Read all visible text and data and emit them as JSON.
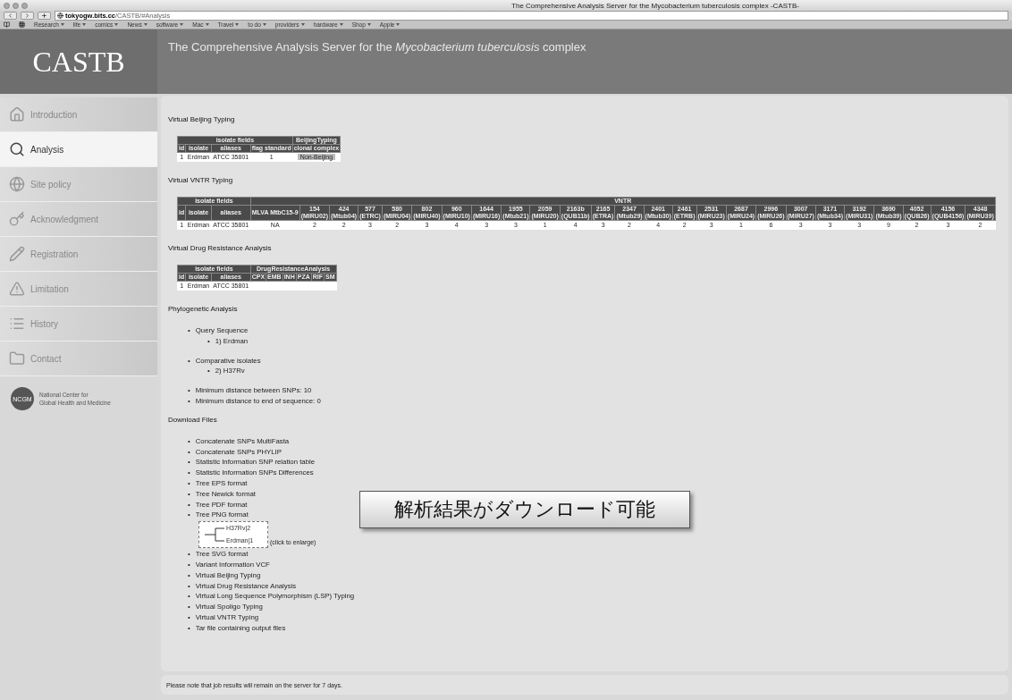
{
  "browser": {
    "title": "The Comprehensive Analysis Server for the Mycobacterium tuberculosis complex -CASTB-",
    "url_host": "tokyogw.bits.cc",
    "url_path": "/CASTB/#Analysis",
    "bookmarks": [
      "Research",
      "life",
      "comics",
      "News",
      "software",
      "Mac",
      "Travel",
      "to do",
      "providers",
      "hardware",
      "Shop",
      "Apple"
    ]
  },
  "header": {
    "logo": "CASTB",
    "tagline": "The Comprehensive Analysis Server for the *Mycobacterium tuberculosis* complex"
  },
  "sidebar": {
    "items": [
      {
        "label": "Introduction",
        "selected": false
      },
      {
        "label": "Analysis",
        "selected": true
      },
      {
        "label": "Site policy",
        "selected": false
      },
      {
        "label": "Acknowledgment",
        "selected": false
      },
      {
        "label": "Registration",
        "selected": false
      },
      {
        "label": "Limitation",
        "selected": false
      },
      {
        "label": "History",
        "selected": false
      },
      {
        "label": "Contact",
        "selected": false
      }
    ],
    "org": {
      "badge": "NCGM",
      "lines": [
        "National Center for",
        "Global Health and Medicine"
      ]
    }
  },
  "sections": [
    {
      "kind": "table",
      "title": "Virtual Beijing Typing",
      "groups": [
        {
          "label": "isolate fields",
          "columns": [
            {
              "label": "id"
            },
            {
              "label": "isolate"
            },
            {
              "label": "aliases"
            },
            {
              "label": "flag standard"
            }
          ]
        },
        {
          "label": "BeijingTyping",
          "columns": [
            {
              "label": "clonal complex"
            }
          ]
        }
      ],
      "rows": [
        [
          {
            "text": "1"
          },
          {
            "text": "Erdman"
          },
          {
            "text": "ATCC 35801"
          },
          {
            "text": "1"
          },
          {
            "text": "Non-Beijing",
            "tag": true
          }
        ]
      ]
    },
    {
      "kind": "table",
      "title": "Virtual VNTR Typing",
      "groups": [
        {
          "label": "isolate fields",
          "columns": [
            {
              "label": "id"
            },
            {
              "label": "isolate"
            },
            {
              "label": "aliases"
            }
          ]
        },
        {
          "label": "VNTR",
          "columns": [
            {
              "label": "MLVA MtbC15-9"
            },
            {
              "label": "154",
              "sub": "(MIRU02)"
            },
            {
              "label": "424",
              "sub": "(Mtub04)"
            },
            {
              "label": "577",
              "sub": "(ETRC)"
            },
            {
              "label": "580",
              "sub": "(MIRU04)"
            },
            {
              "label": "802",
              "sub": "(MIRU40)"
            },
            {
              "label": "960",
              "sub": "(MIRU10)"
            },
            {
              "label": "1644",
              "sub": "(MIRU16)"
            },
            {
              "label": "1955",
              "sub": "(Mtub21)"
            },
            {
              "label": "2059",
              "sub": "(MIRU20)"
            },
            {
              "label": "2163b",
              "sub": "(QUB11b)"
            },
            {
              "label": "2165",
              "sub": "(ETRA)"
            },
            {
              "label": "2347",
              "sub": "(Mtub29)"
            },
            {
              "label": "2401",
              "sub": "(Mtub30)"
            },
            {
              "label": "2461",
              "sub": "(ETRB)"
            },
            {
              "label": "2531",
              "sub": "(MIRU23)"
            },
            {
              "label": "2687",
              "sub": "(MIRU24)"
            },
            {
              "label": "2996",
              "sub": "(MIRU26)"
            },
            {
              "label": "3007",
              "sub": "(MIRU27)"
            },
            {
              "label": "3171",
              "sub": "(Mtub34)"
            },
            {
              "label": "3192",
              "sub": "(MIRU31)"
            },
            {
              "label": "3690",
              "sub": "(Mtub39)"
            },
            {
              "label": "4052",
              "sub": "(QUB26)"
            },
            {
              "label": "4156",
              "sub": "(QUB4156)"
            },
            {
              "label": "4348",
              "sub": "(MIRU39)"
            }
          ]
        }
      ],
      "rows": [
        [
          {
            "text": "1"
          },
          {
            "text": "Erdman"
          },
          {
            "text": "ATCC 35801"
          },
          {
            "text": "NA"
          },
          {
            "text": "2"
          },
          {
            "text": "2"
          },
          {
            "text": "3"
          },
          {
            "text": "2"
          },
          {
            "text": "3"
          },
          {
            "text": "4"
          },
          {
            "text": "3"
          },
          {
            "text": "3"
          },
          {
            "text": "1"
          },
          {
            "text": "4"
          },
          {
            "text": "3"
          },
          {
            "text": "2"
          },
          {
            "text": "4"
          },
          {
            "text": "2"
          },
          {
            "text": "3"
          },
          {
            "text": "1"
          },
          {
            "text": "6"
          },
          {
            "text": "3"
          },
          {
            "text": "3"
          },
          {
            "text": "3"
          },
          {
            "text": "9"
          },
          {
            "text": "2"
          },
          {
            "text": "3"
          },
          {
            "text": "2"
          }
        ]
      ]
    },
    {
      "kind": "table",
      "title": "Virtual Drug Resistance Analysis",
      "groups": [
        {
          "label": "isolate fields",
          "columns": [
            {
              "label": "id"
            },
            {
              "label": "isolate"
            },
            {
              "label": "aliases"
            }
          ]
        },
        {
          "label": "DrugResistanceAnalysis",
          "columns": [
            {
              "label": "CPX"
            },
            {
              "label": "EMB"
            },
            {
              "label": "INH"
            },
            {
              "label": "PZA"
            },
            {
              "label": "RIF"
            },
            {
              "label": "SM"
            }
          ]
        }
      ],
      "rows": [
        [
          {
            "text": "1"
          },
          {
            "text": "Erdman"
          },
          {
            "text": "ATCC 35801"
          }
        ]
      ]
    },
    {
      "kind": "list",
      "title": "Phylogenetic Analysis",
      "items": [
        {
          "bullet": "•",
          "label": "Query Sequence",
          "children": [
            {
              "bullet": "•",
              "label": "1) Erdman"
            }
          ]
        },
        {
          "bullet": "•",
          "label": "Comparative isolates",
          "children": [
            {
              "bullet": "•",
              "label": "2) H37Rv"
            }
          ]
        },
        {
          "bullet": "•",
          "label": "Minimum distance between SNPs: 10"
        },
        {
          "bullet": "•",
          "label": "Minimum distance to end of sequence: 0"
        }
      ]
    },
    {
      "kind": "list",
      "title": "Download Files",
      "items": [
        {
          "kind": "link",
          "bullet": "•",
          "label": "Concatenate SNPs MultiFasta"
        },
        {
          "kind": "link",
          "bullet": "•",
          "label": "Concatenate SNPs PHYLIP"
        },
        {
          "kind": "link",
          "bullet": "•",
          "label": "Statistic Information SNP relation table"
        },
        {
          "kind": "link",
          "bullet": "•",
          "label": "Statistic Information SNPs Differences"
        },
        {
          "kind": "link",
          "bullet": "•",
          "label": "Tree EPS format"
        },
        {
          "kind": "link",
          "bullet": "•",
          "label": "Tree Newick format"
        },
        {
          "kind": "link",
          "bullet": "•",
          "label": "Tree PDF format"
        },
        {
          "kind": "link",
          "bullet": "•",
          "label": "Tree PNG format"
        },
        {
          "kind": "preview",
          "leaves": [
            "H37Rv|2",
            "Erdman|1"
          ],
          "caption": "(click to enlarge)"
        },
        {
          "kind": "link",
          "bullet": "•",
          "label": "Tree SVG format"
        },
        {
          "kind": "link",
          "bullet": "•",
          "label": "Variant Information VCF"
        },
        {
          "kind": "link",
          "bullet": "•",
          "label": "Virtual Beijing Typing"
        },
        {
          "kind": "link",
          "bullet": "•",
          "label": "Virtual Drug Resistance Analysis"
        },
        {
          "kind": "link",
          "bullet": "•",
          "label": "Virtual Long Sequence Polymorphism (LSP) Typing"
        },
        {
          "kind": "link",
          "bullet": "•",
          "label": "Virtual Spoligo Typing"
        },
        {
          "kind": "link",
          "bullet": "•",
          "label": "Virtual VNTR Typing"
        },
        {
          "kind": "link",
          "bullet": "•",
          "label": "Tar file containing output files"
        }
      ]
    }
  ],
  "callout": "解析結果がダウンロード可能",
  "note": "Please note that job results will remain on the server for 7 days."
}
